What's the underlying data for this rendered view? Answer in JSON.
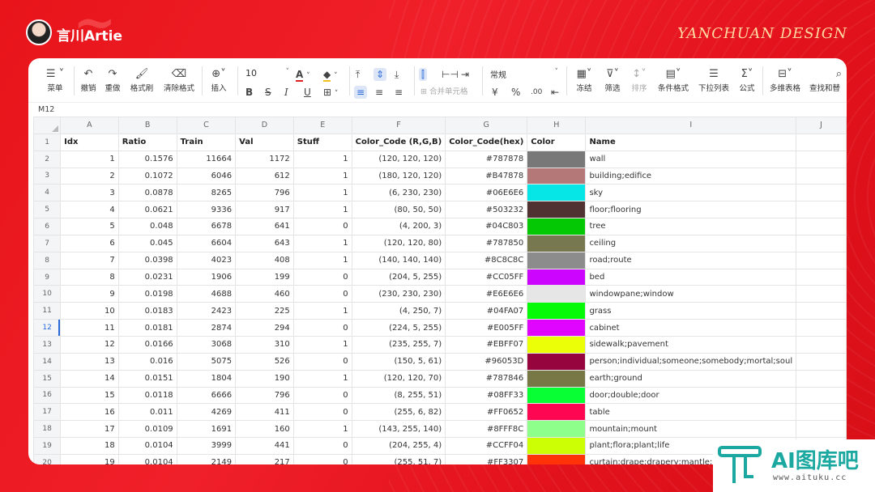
{
  "header": {
    "brand": "言川Artie",
    "design_brand": "YANCHUAN DESIGN"
  },
  "toolbar": {
    "menu_label": "菜单",
    "undo_label": "撤销",
    "redo_label": "重做",
    "format_painter_label": "格式刷",
    "clear_format_label": "清除格式",
    "insert_label": "插入",
    "font_size": "10",
    "merge_cells_label": "合并单元格",
    "number_format": "常规",
    "currency_symbol": "¥",
    "percent_symbol": "%",
    "decimal_symbol": ".00",
    "freeze_label": "冻结",
    "filter_label": "筛选",
    "sort_label": "排序",
    "conditional_format_label": "条件格式",
    "dropdown_list_label": "下拉列表",
    "formula_label": "公式",
    "multi_table_label": "多维表格",
    "find_replace_label": "查找和替"
  },
  "cell_reference": "M12",
  "columns": [
    "A",
    "B",
    "C",
    "D",
    "E",
    "F",
    "G",
    "H",
    "I",
    "J"
  ],
  "table_headers": [
    "Idx",
    "Ratio",
    "Train",
    "Val",
    "Stuff",
    "Color_Code (R,G,B)",
    "Color_Code(hex)",
    "Color",
    "Name",
    ""
  ],
  "row_numbers": [
    "1",
    "2",
    "3",
    "4",
    "5",
    "6",
    "7",
    "8",
    "9",
    "10",
    "11",
    "12",
    "13",
    "14",
    "15",
    "16",
    "17",
    "18",
    "19",
    "20"
  ],
  "selected_row": "12",
  "rows": [
    {
      "idx": "1",
      "ratio": "0.1576",
      "train": "11664",
      "val": "1172",
      "stuff": "1",
      "rgb": "(120, 120, 120)",
      "hex": "#787878",
      "color": "#787878",
      "name": "wall"
    },
    {
      "idx": "2",
      "ratio": "0.1072",
      "train": "6046",
      "val": "612",
      "stuff": "1",
      "rgb": "(180, 120, 120)",
      "hex": "#B47878",
      "color": "#B47878",
      "name": "building;edifice"
    },
    {
      "idx": "3",
      "ratio": "0.0878",
      "train": "8265",
      "val": "796",
      "stuff": "1",
      "rgb": "(6, 230, 230)",
      "hex": "#06E6E6",
      "color": "#06E6E6",
      "name": "sky"
    },
    {
      "idx": "4",
      "ratio": "0.0621",
      "train": "9336",
      "val": "917",
      "stuff": "1",
      "rgb": "(80, 50, 50)",
      "hex": "#503232",
      "color": "#503232",
      "name": "floor;flooring"
    },
    {
      "idx": "5",
      "ratio": "0.048",
      "train": "6678",
      "val": "641",
      "stuff": "0",
      "rgb": "(4, 200, 3)",
      "hex": "#04C803",
      "color": "#04C803",
      "name": "tree"
    },
    {
      "idx": "6",
      "ratio": "0.045",
      "train": "6604",
      "val": "643",
      "stuff": "1",
      "rgb": "(120, 120, 80)",
      "hex": "#787850",
      "color": "#787850",
      "name": "ceiling"
    },
    {
      "idx": "7",
      "ratio": "0.0398",
      "train": "4023",
      "val": "408",
      "stuff": "1",
      "rgb": "(140, 140, 140)",
      "hex": "#8C8C8C",
      "color": "#8C8C8C",
      "name": "road;route"
    },
    {
      "idx": "8",
      "ratio": "0.0231",
      "train": "1906",
      "val": "199",
      "stuff": "0",
      "rgb": "(204, 5, 255)",
      "hex": "#CC05FF",
      "color": "#CC05FF",
      "name": "bed"
    },
    {
      "idx": "9",
      "ratio": "0.0198",
      "train": "4688",
      "val": "460",
      "stuff": "0",
      "rgb": "(230, 230, 230)",
      "hex": "#E6E6E6",
      "color": "#E6E6E6",
      "name": "windowpane;window"
    },
    {
      "idx": "10",
      "ratio": "0.0183",
      "train": "2423",
      "val": "225",
      "stuff": "1",
      "rgb": "(4, 250, 7)",
      "hex": "#04FA07",
      "color": "#04FA07",
      "name": "grass"
    },
    {
      "idx": "11",
      "ratio": "0.0181",
      "train": "2874",
      "val": "294",
      "stuff": "0",
      "rgb": "(224, 5, 255)",
      "hex": "#E005FF",
      "color": "#E005FF",
      "name": "cabinet"
    },
    {
      "idx": "12",
      "ratio": "0.0166",
      "train": "3068",
      "val": "310",
      "stuff": "1",
      "rgb": "(235, 255, 7)",
      "hex": "#EBFF07",
      "color": "#EBFF07",
      "name": "sidewalk;pavement"
    },
    {
      "idx": "13",
      "ratio": "0.016",
      "train": "5075",
      "val": "526",
      "stuff": "0",
      "rgb": "(150, 5, 61)",
      "hex": "#96053D",
      "color": "#96053D",
      "name": "person;individual;someone;somebody;mortal;soul"
    },
    {
      "idx": "14",
      "ratio": "0.0151",
      "train": "1804",
      "val": "190",
      "stuff": "1",
      "rgb": "(120, 120, 70)",
      "hex": "#787846",
      "color": "#787846",
      "name": "earth;ground"
    },
    {
      "idx": "15",
      "ratio": "0.0118",
      "train": "6666",
      "val": "796",
      "stuff": "0",
      "rgb": "(8, 255, 51)",
      "hex": "#08FF33",
      "color": "#08FF33",
      "name": "door;double;door"
    },
    {
      "idx": "16",
      "ratio": "0.011",
      "train": "4269",
      "val": "411",
      "stuff": "0",
      "rgb": "(255, 6, 82)",
      "hex": "#FF0652",
      "color": "#FF0652",
      "name": "table"
    },
    {
      "idx": "17",
      "ratio": "0.0109",
      "train": "1691",
      "val": "160",
      "stuff": "1",
      "rgb": "(143, 255, 140)",
      "hex": "#8FFF8C",
      "color": "#8FFF8C",
      "name": "mountain;mount"
    },
    {
      "idx": "18",
      "ratio": "0.0104",
      "train": "3999",
      "val": "441",
      "stuff": "0",
      "rgb": "(204, 255, 4)",
      "hex": "#CCFF04",
      "color": "#CCFF04",
      "name": "plant;flora;plant;life"
    },
    {
      "idx": "19",
      "ratio": "0.0104",
      "train": "2149",
      "val": "217",
      "stuff": "0",
      "rgb": "(255, 51, 7)",
      "hex": "#FF3307",
      "color": "#FF3307",
      "name": "curtain;drape;drapery;mantle;p"
    }
  ],
  "watermark": {
    "title": "AI图库吧",
    "url": "www.aituku.cc"
  },
  "colors": {
    "accent_blue": "#2a6ad8",
    "background_red": "#e8141a",
    "logo_teal": "#1aa8a0"
  }
}
